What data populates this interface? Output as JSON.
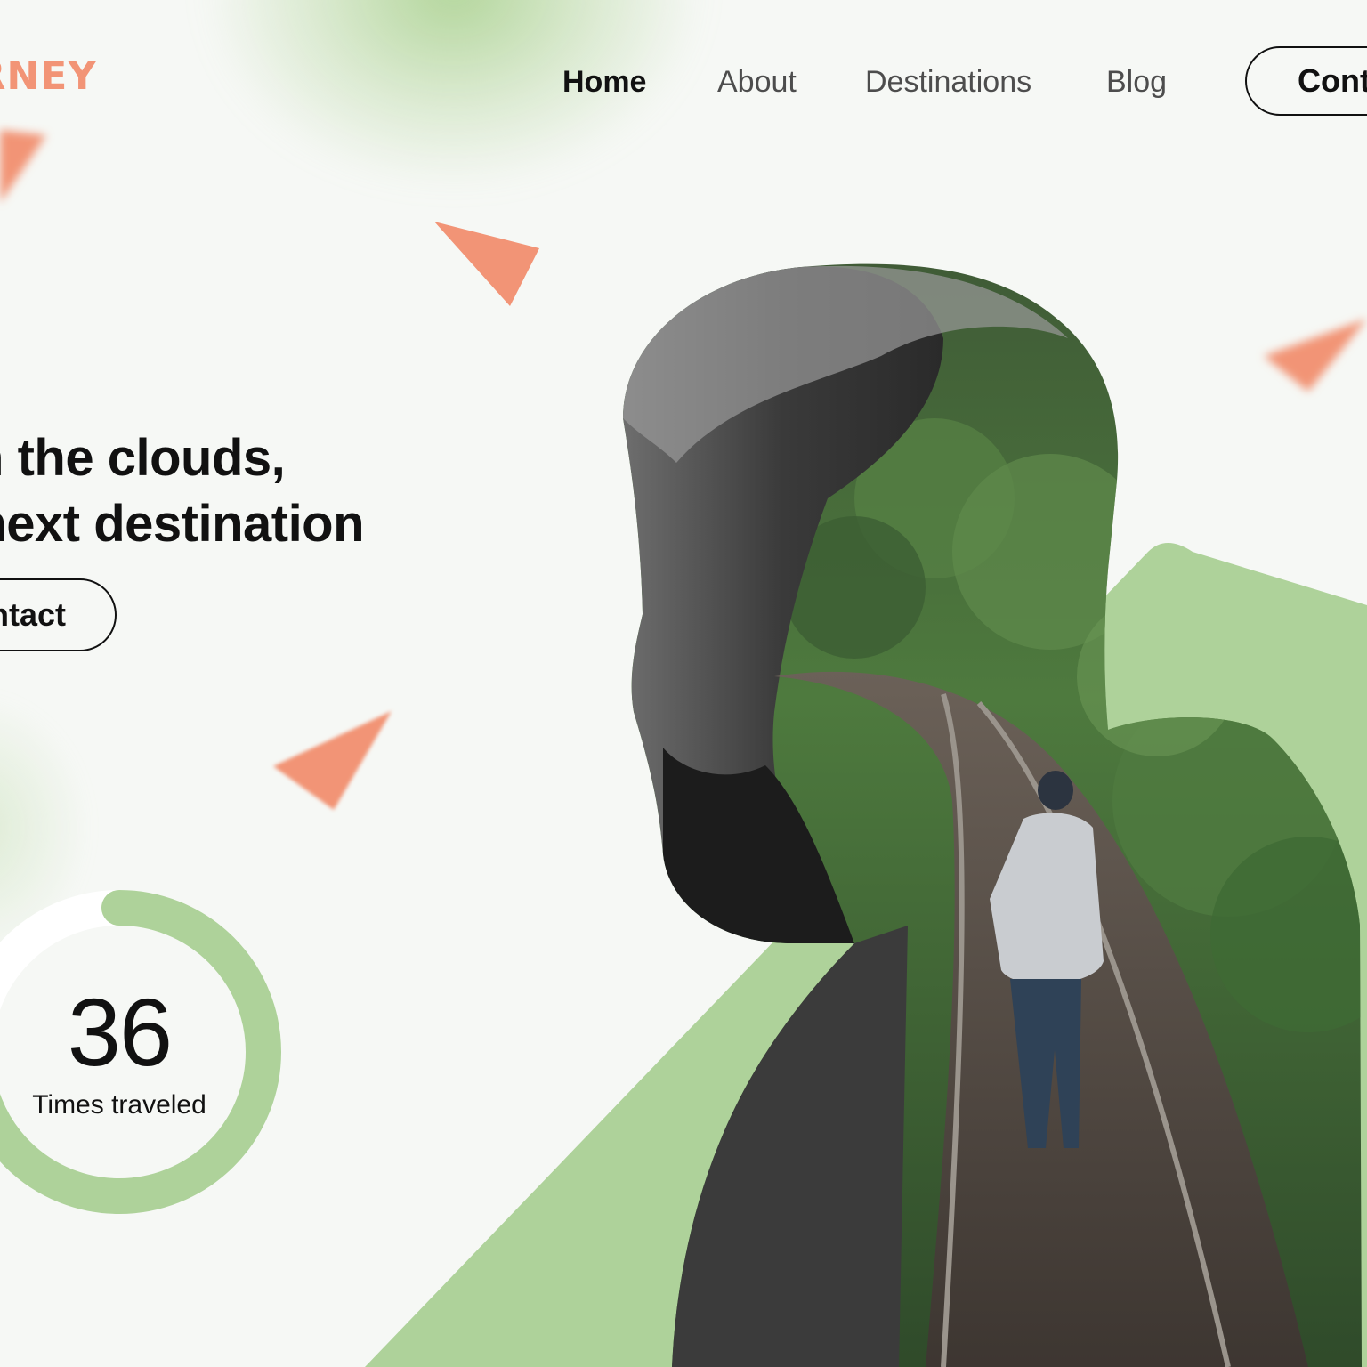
{
  "brand": {
    "logo_text": "JOURNEY",
    "accent_color": "#f29476",
    "green_color": "#aed29a"
  },
  "nav": {
    "items": [
      {
        "label": "Home",
        "active": true
      },
      {
        "label": "About",
        "active": false
      },
      {
        "label": "Destinations",
        "active": false
      },
      {
        "label": "Blog",
        "active": false
      }
    ],
    "contact_label": "Contact"
  },
  "hero": {
    "headline_line1": "Head in the clouds,",
    "headline_line2": "Off to the next destination",
    "contact_label": "Contact"
  },
  "stats": {
    "number": "36",
    "label": "Times traveled",
    "ring_progress": 0.75
  },
  "image": {
    "icon": "double-exposure-portrait"
  }
}
